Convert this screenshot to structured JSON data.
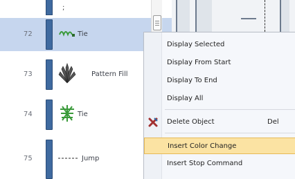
{
  "list": {
    "top_mark": ";",
    "rows": [
      {
        "number": "72",
        "label": "Tie",
        "selected": true
      },
      {
        "number": "73",
        "label": "Pattern Fill",
        "selected": false
      },
      {
        "number": "74",
        "label": "Tie",
        "selected": false
      },
      {
        "number": "75",
        "label": "Jump",
        "selected": false
      }
    ]
  },
  "context_menu": {
    "items": [
      {
        "label": "Display Selected",
        "shortcut": ""
      },
      {
        "label": "Display From Start",
        "shortcut": ""
      },
      {
        "label": "Display To End",
        "shortcut": ""
      },
      {
        "label": "Display All",
        "shortcut": ""
      },
      {
        "label": "Delete Object",
        "shortcut": "Del",
        "icon": "delete-x-icon"
      },
      {
        "label": "Insert Color Change",
        "shortcut": "",
        "highlighted": true
      },
      {
        "label": "Insert Stop Command",
        "shortcut": ""
      }
    ]
  },
  "colors": {
    "selected_row": "#c6d6ee",
    "color_bar": "#3f6a9f",
    "menu_highlight": "#fbe3a3",
    "thumb_green": "#3a9a3a"
  }
}
